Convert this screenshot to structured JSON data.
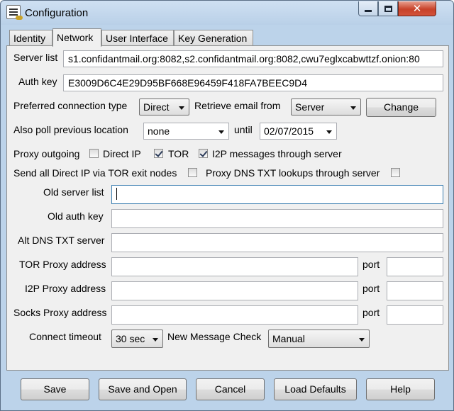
{
  "window": {
    "title": "Configuration"
  },
  "tabs": [
    {
      "label": "Identity"
    },
    {
      "label": "Network",
      "active": true
    },
    {
      "label": "User Interface"
    },
    {
      "label": "Key Generation"
    }
  ],
  "network": {
    "server_list_label": "Server list",
    "server_list_value": "s1.confidantmail.org:8082,s2.confidantmail.org:8082,cwu7eglxcabwttzf.onion:80",
    "auth_key_label": "Auth key",
    "auth_key_value": "E3009D6C4E29D95BF668E96459F418FA7BEEC9D4",
    "preferred_connection_label": "Preferred connection type",
    "preferred_connection_value": "Direct",
    "retrieve_email_label": "Retrieve email from",
    "retrieve_email_value": "Server",
    "change_label": "Change",
    "also_poll_label": "Also poll previous location",
    "also_poll_value": "none",
    "until_label": "until",
    "until_value": "02/07/2015",
    "proxy_outgoing_label": "Proxy outgoing",
    "direct_ip_label": "Direct IP",
    "direct_ip_checked": false,
    "tor_label": "TOR",
    "tor_checked": true,
    "i2p_label": "I2P messages through server",
    "i2p_checked": true,
    "send_all_direct_label": "Send all Direct IP via TOR exit nodes",
    "send_all_direct_checked": false,
    "proxy_dns_label": "Proxy DNS TXT lookups through server",
    "proxy_dns_checked": false,
    "old_server_list_label": "Old server list",
    "old_server_list_value": "",
    "old_auth_key_label": "Old auth key",
    "old_auth_key_value": "",
    "alt_dns_label": "Alt DNS TXT server",
    "alt_dns_value": "",
    "tor_proxy_label": "TOR Proxy address",
    "tor_proxy_value": "",
    "i2p_proxy_label": "I2P Proxy address",
    "i2p_proxy_value": "",
    "socks_proxy_label": "Socks Proxy address",
    "socks_proxy_value": "",
    "port_label": "port",
    "tor_port_value": "",
    "i2p_port_value": "",
    "socks_port_value": "",
    "connect_timeout_label": "Connect timeout",
    "connect_timeout_value": "30 sec",
    "new_message_check_label": "New Message Check",
    "new_message_check_value": "Manual"
  },
  "buttons": {
    "save": "Save",
    "save_and_open": "Save and Open",
    "cancel": "Cancel",
    "load_defaults": "Load Defaults",
    "help": "Help"
  }
}
